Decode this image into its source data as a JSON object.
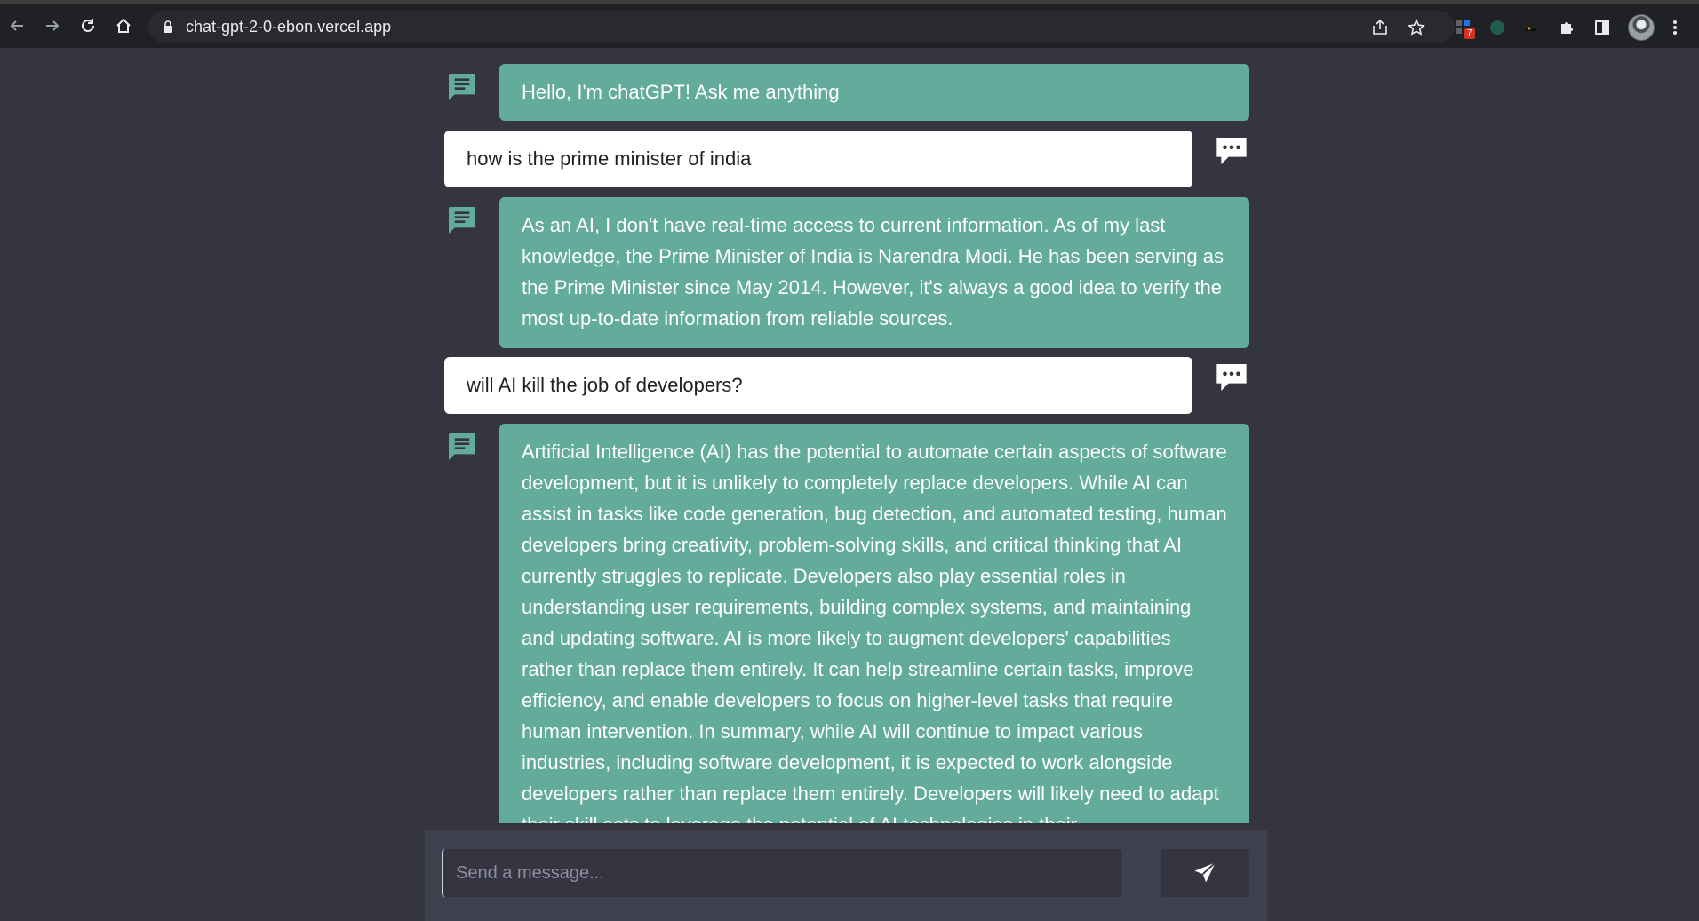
{
  "browser": {
    "url": "chat-gpt-2-0-ebon.vercel.app",
    "extension_badge": "7"
  },
  "messages": [
    {
      "role": "bot",
      "text": "Hello, I'm chatGPT! Ask me anything"
    },
    {
      "role": "user",
      "text": "how is the prime minister of india"
    },
    {
      "role": "bot",
      "text": "As an AI, I don't have real-time access to current information. As of my last knowledge, the Prime Minister of India is Narendra Modi. He has been serving as the Prime Minister since May 2014. However, it's always a good idea to verify the most up-to-date information from reliable sources."
    },
    {
      "role": "user",
      "text": "will AI kill the job of developers?"
    },
    {
      "role": "bot",
      "text": "Artificial Intelligence (AI) has the potential to automate certain aspects of software development, but it is unlikely to completely replace developers. While AI can assist in tasks like code generation, bug detection, and automated testing, human developers bring creativity, problem-solving skills, and critical thinking that AI currently struggles to replicate. Developers also play essential roles in understanding user requirements, building complex systems, and maintaining and updating software. AI is more likely to augment developers' capabilities rather than replace them entirely. It can help streamline certain tasks, improve efficiency, and enable developers to focus on higher-level tasks that require human intervention. In summary, while AI will continue to impact various industries, including software development, it is expected to work alongside developers rather than replace them entirely. Developers will likely need to adapt their skill sets to leverage the potential of AI technologies in their"
    }
  ],
  "composer": {
    "placeholder": "Send a message..."
  },
  "colors": {
    "background": "#343541",
    "bot_bubble": "#63ab9b",
    "user_bubble": "#ffffff",
    "input_area": "#40414f"
  },
  "icons": {
    "bot": "chat-icon",
    "user": "comment-dots-icon",
    "send": "send-icon"
  }
}
